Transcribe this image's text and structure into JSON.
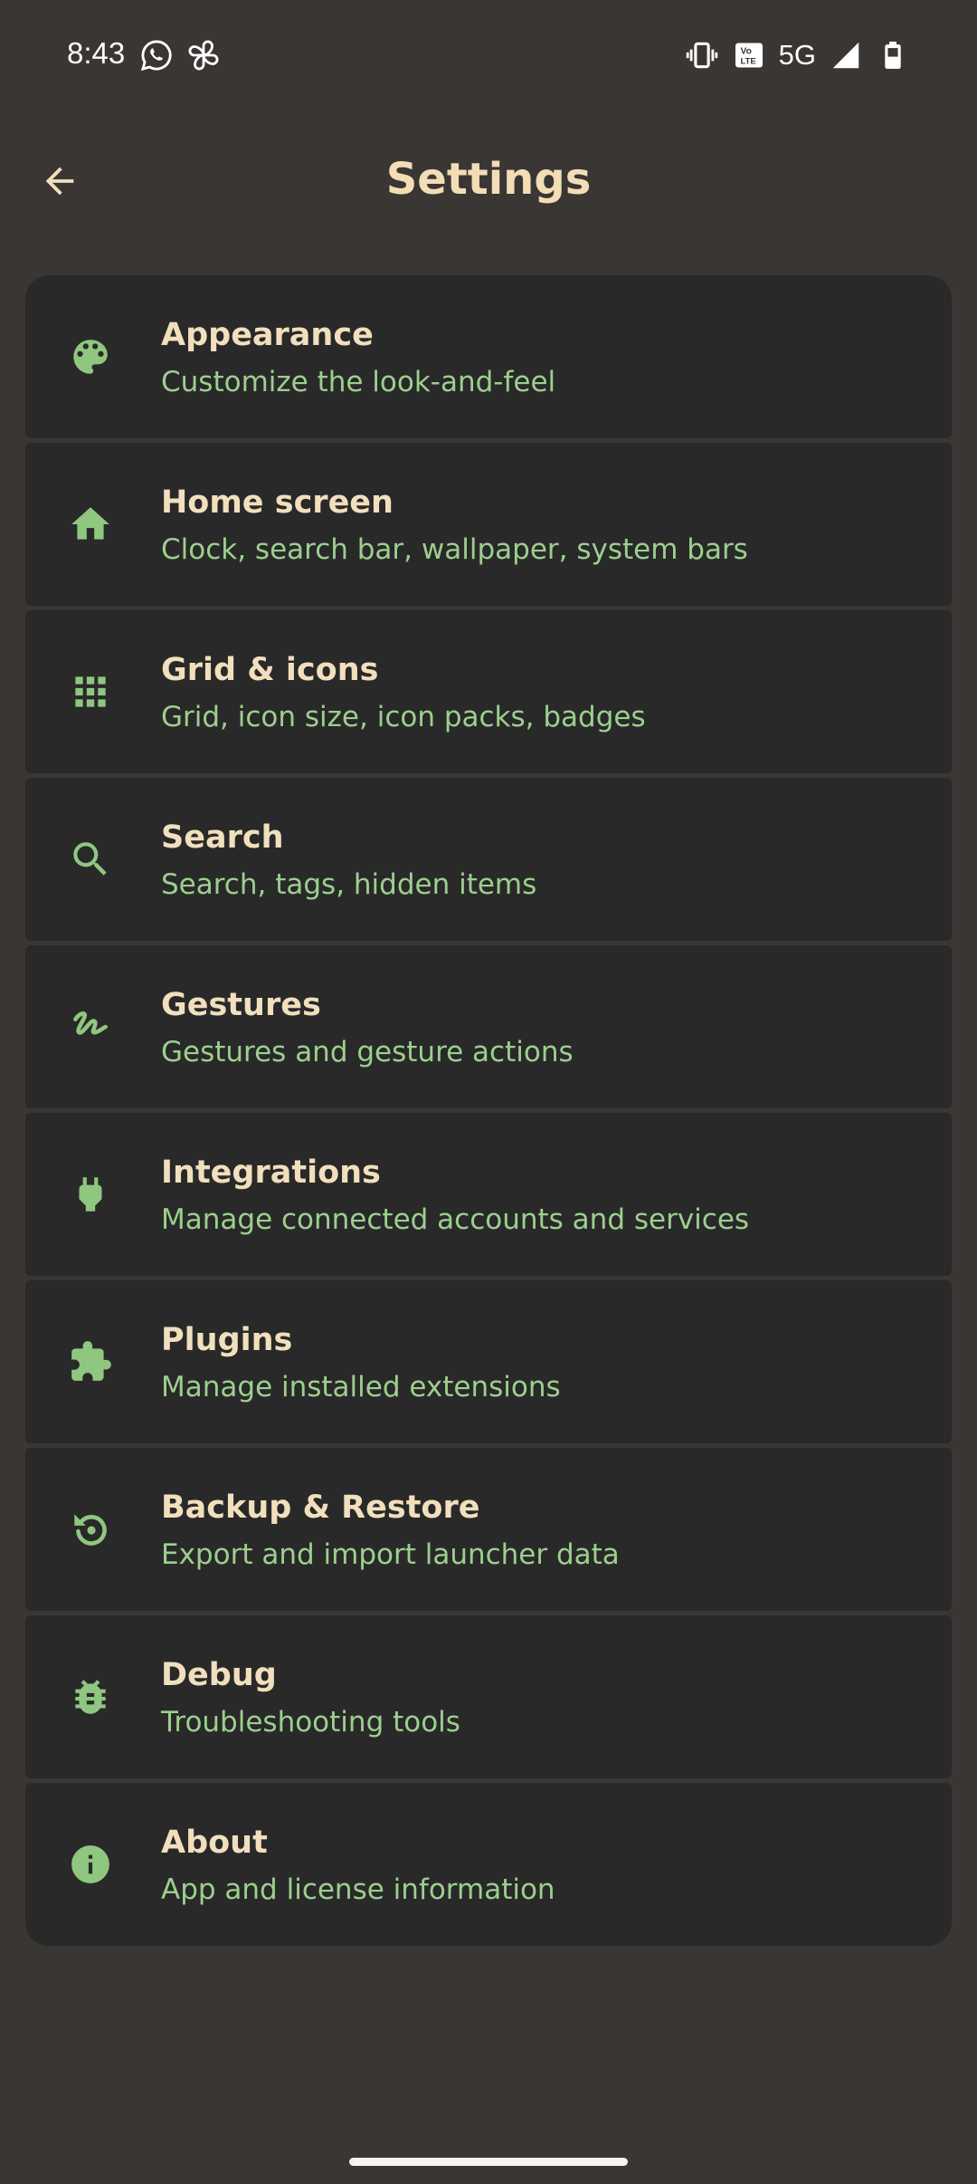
{
  "status_bar": {
    "time": "8:43",
    "network": "5G",
    "left_icons": [
      "whatsapp-icon",
      "pinwheel-icon"
    ],
    "right_icons": [
      "vibrate-icon",
      "volte-icon",
      "signal-icon",
      "battery-icon"
    ]
  },
  "header": {
    "title": "Settings",
    "back_icon": "arrow-back-icon"
  },
  "colors": {
    "background": "#3a3634",
    "card": "#292929",
    "title_text": "#f1dfbd",
    "subtitle_text": "#9ccf8e",
    "icon": "#8fc781"
  },
  "settings": {
    "items": [
      {
        "icon": "palette-icon",
        "title": "Appearance",
        "subtitle": "Customize the look-and-feel"
      },
      {
        "icon": "home-icon",
        "title": "Home screen",
        "subtitle": "Clock, search bar, wallpaper, system bars"
      },
      {
        "icon": "grid-icon",
        "title": "Grid & icons",
        "subtitle": "Grid, icon size, icon packs, badges"
      },
      {
        "icon": "search-icon",
        "title": "Search",
        "subtitle": "Search, tags, hidden items"
      },
      {
        "icon": "gesture-icon",
        "title": "Gestures",
        "subtitle": "Gestures and gesture actions"
      },
      {
        "icon": "plug-icon",
        "title": "Integrations",
        "subtitle": "Manage connected accounts and services"
      },
      {
        "icon": "puzzle-icon",
        "title": "Plugins",
        "subtitle": "Manage installed extensions"
      },
      {
        "icon": "restore-icon",
        "title": "Backup & Restore",
        "subtitle": "Export and import launcher data"
      },
      {
        "icon": "bug-icon",
        "title": "Debug",
        "subtitle": "Troubleshooting tools"
      },
      {
        "icon": "info-icon",
        "title": "About",
        "subtitle": "App and license information"
      }
    ]
  }
}
